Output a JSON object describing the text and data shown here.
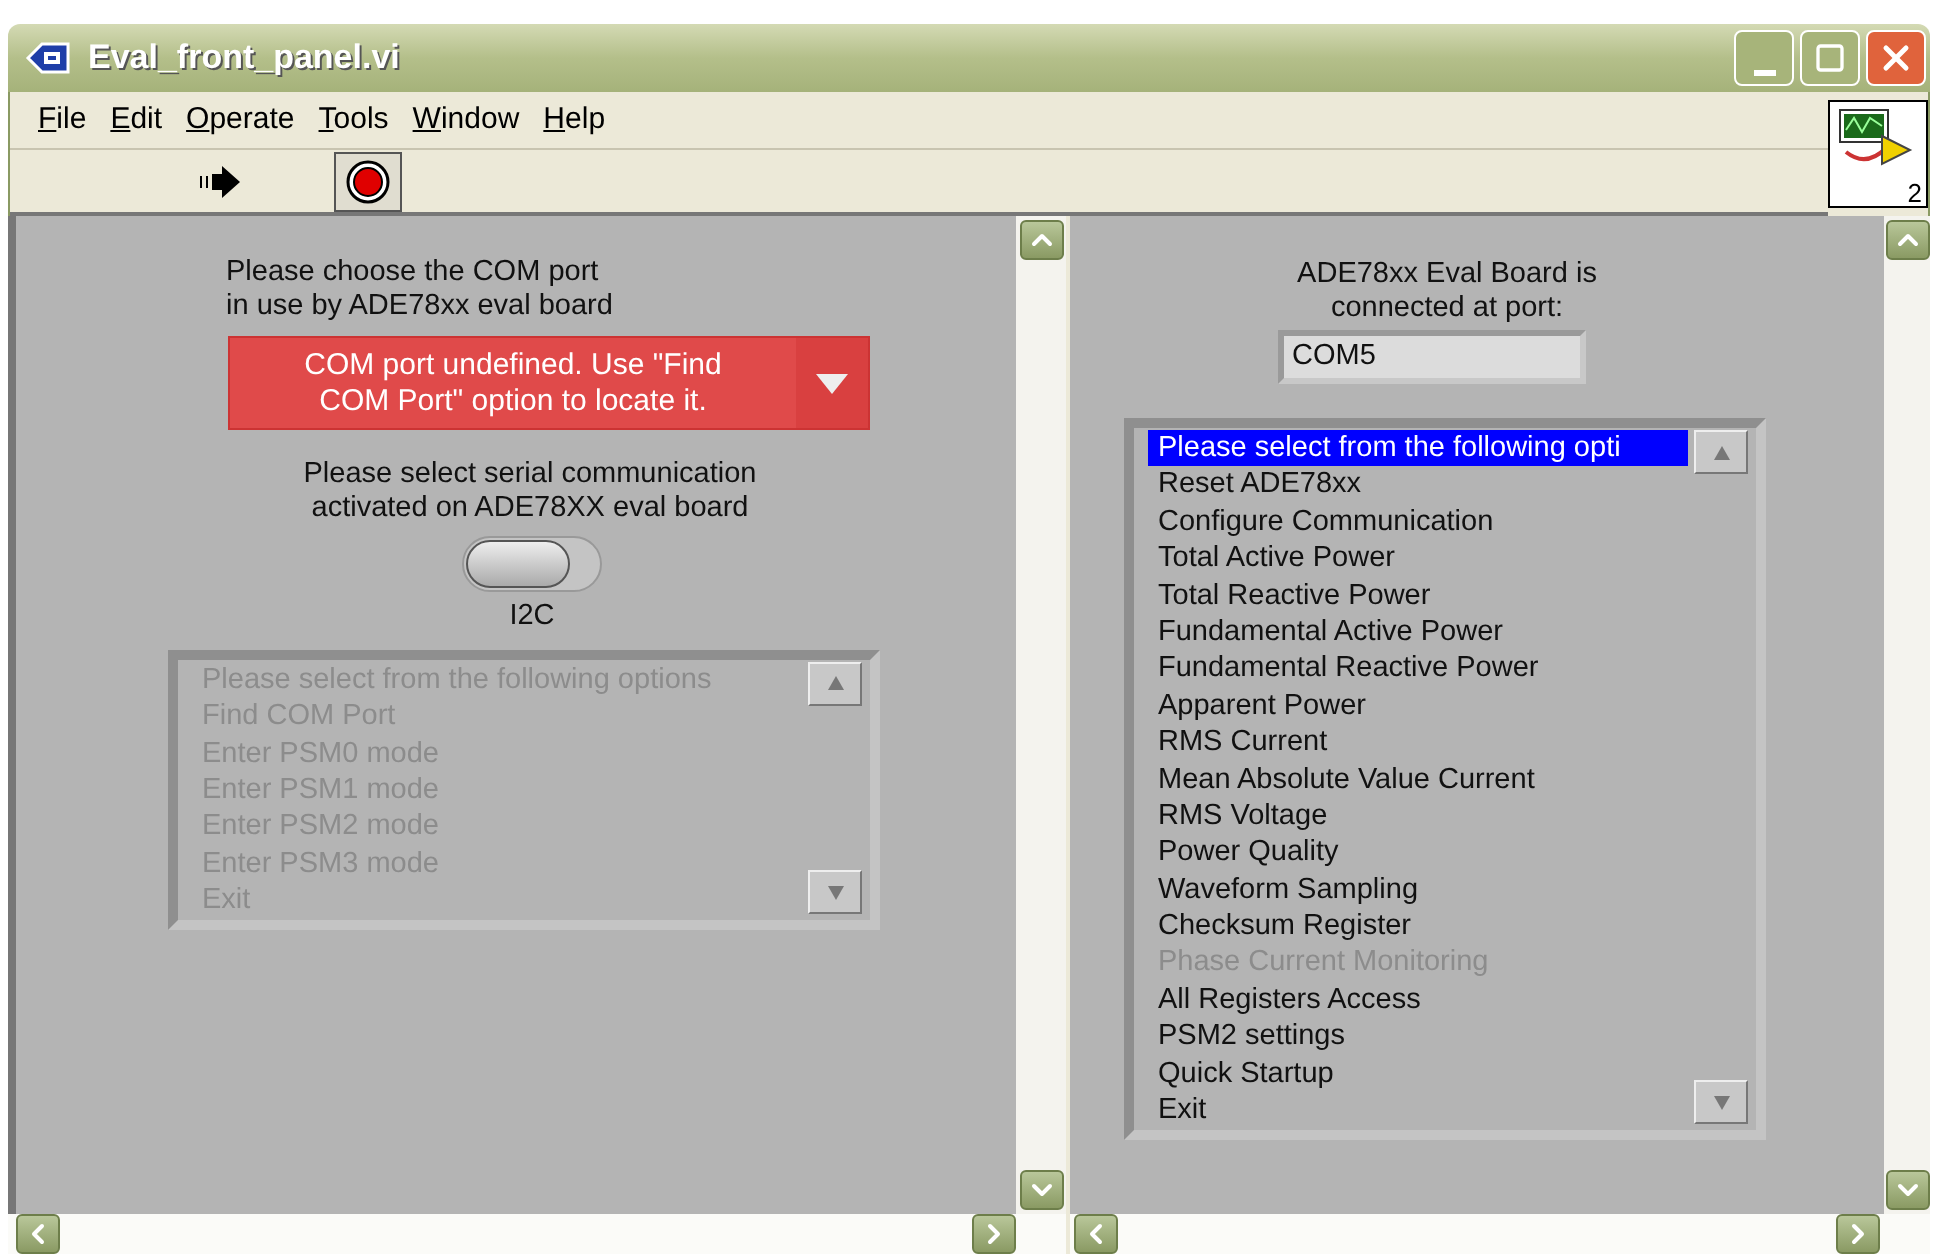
{
  "window": {
    "title": "Eval_front_panel.vi"
  },
  "menu": [
    "File",
    "Edit",
    "Operate",
    "Tools",
    "Window",
    "Help"
  ],
  "vi_icon": {
    "label": "2"
  },
  "left_panel": {
    "port_prompt": "Please choose the COM port\nin use by ADE78xx eval board",
    "port_dropdown": {
      "value": "COM port undefined. Use \"Find\nCOM Port\" option to locate it."
    },
    "serial_prompt": "Please select serial communication\nactivated on ADE78XX eval board",
    "serial_switch": {
      "on": false,
      "label": "I2C"
    },
    "options_list": {
      "disabled": true,
      "items": [
        {
          "label": "Please select from the following options",
          "selected": false
        },
        {
          "label": "Find COM Port",
          "selected": false
        },
        {
          "label": "Enter PSM0 mode",
          "selected": false
        },
        {
          "label": "Enter PSM1 mode",
          "selected": false
        },
        {
          "label": "Enter PSM2 mode",
          "selected": false
        },
        {
          "label": "Enter PSM3 mode",
          "selected": false
        },
        {
          "label": "Exit",
          "selected": false
        }
      ]
    }
  },
  "right_panel": {
    "connected_label": "ADE78xx Eval Board is\nconnected at port:",
    "port_field": {
      "value": "COM5"
    },
    "options_list": {
      "disabled": false,
      "items": [
        {
          "label": "Please select from the following opti",
          "selected": true,
          "disabled": false
        },
        {
          "label": "Reset ADE78xx",
          "selected": false,
          "disabled": false
        },
        {
          "label": "Configure Communication",
          "selected": false,
          "disabled": false
        },
        {
          "label": "Total Active Power",
          "selected": false,
          "disabled": false
        },
        {
          "label": "Total Reactive Power",
          "selected": false,
          "disabled": false
        },
        {
          "label": "Fundamental Active Power",
          "selected": false,
          "disabled": false
        },
        {
          "label": "Fundamental Reactive Power",
          "selected": false,
          "disabled": false
        },
        {
          "label": "Apparent Power",
          "selected": false,
          "disabled": false
        },
        {
          "label": "RMS Current",
          "selected": false,
          "disabled": false
        },
        {
          "label": "Mean Absolute Value Current",
          "selected": false,
          "disabled": false
        },
        {
          "label": "RMS Voltage",
          "selected": false,
          "disabled": false
        },
        {
          "label": "Power Quality",
          "selected": false,
          "disabled": false
        },
        {
          "label": "Waveform Sampling",
          "selected": false,
          "disabled": false
        },
        {
          "label": "Checksum Register",
          "selected": false,
          "disabled": false
        },
        {
          "label": "Phase Current Monitoring",
          "selected": false,
          "disabled": true
        },
        {
          "label": "All Registers Access",
          "selected": false,
          "disabled": false
        },
        {
          "label": "PSM2 settings",
          "selected": false,
          "disabled": false
        },
        {
          "label": "Quick Startup",
          "selected": false,
          "disabled": false
        },
        {
          "label": "Exit",
          "selected": false,
          "disabled": false
        }
      ]
    }
  }
}
